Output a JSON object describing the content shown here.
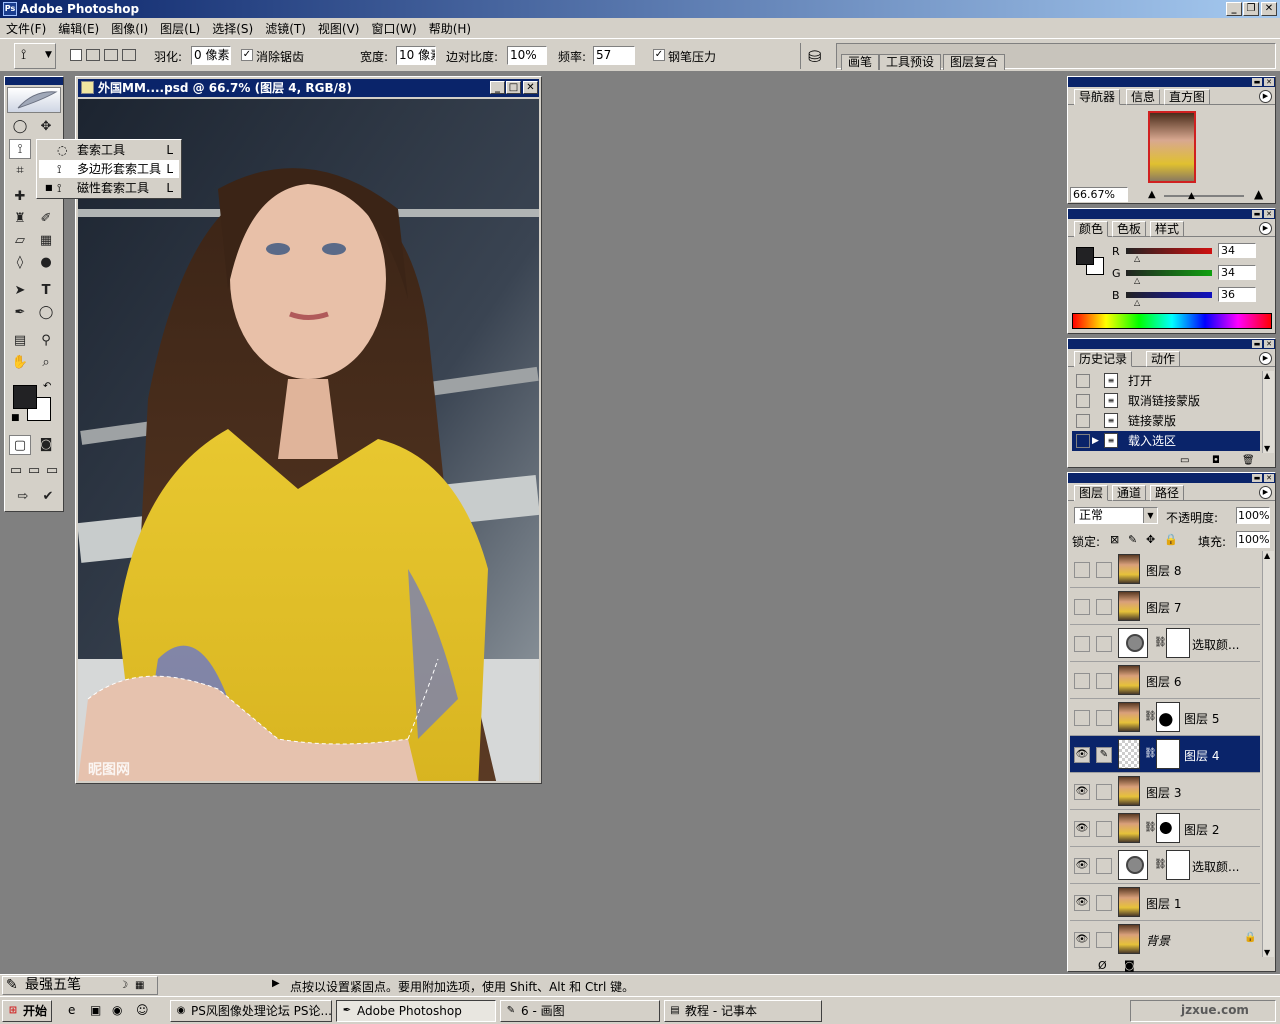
{
  "app": {
    "title": "Adobe Photoshop"
  },
  "menu": [
    "文件(F)",
    "编辑(E)",
    "图像(I)",
    "图层(L)",
    "选择(S)",
    "滤镜(T)",
    "视图(V)",
    "窗口(W)",
    "帮助(H)"
  ],
  "options": {
    "feather_label": "羽化:",
    "feather_value": "0 像素",
    "antialias_label": "消除锯齿",
    "width_label": "宽度:",
    "width_value": "10 像素",
    "edge_contrast_label": "边对比度:",
    "edge_contrast_value": "10%",
    "frequency_label": "频率:",
    "frequency_value": "57",
    "pen_pressure_label": "钢笔压力",
    "dock_tabs": [
      "画笔",
      "工具预设",
      "图层复合"
    ]
  },
  "flyout": {
    "items": [
      {
        "label": "套索工具",
        "key": "L"
      },
      {
        "label": "多边形套索工具",
        "key": "L"
      },
      {
        "label": "磁性套索工具",
        "key": "L"
      }
    ]
  },
  "document": {
    "title": "外国MM....psd @ 66.7% (图层 4, RGB/8)",
    "watermark": "昵图网"
  },
  "navigator": {
    "tabs": [
      "导航器",
      "信息",
      "直方图"
    ],
    "zoom": "66.67%"
  },
  "color": {
    "tabs": [
      "颜色",
      "色板",
      "样式"
    ],
    "channels": [
      {
        "name": "R",
        "value": "34",
        "color": "#d01010"
      },
      {
        "name": "G",
        "value": "34",
        "color": "#10a010"
      },
      {
        "name": "B",
        "value": "36",
        "color": "#1010c0"
      }
    ]
  },
  "history": {
    "tabs": [
      "历史记录",
      "动作"
    ],
    "items": [
      "打开",
      "取消链接蒙版",
      "链接蒙版",
      "载入选区"
    ]
  },
  "layers": {
    "tabs": [
      "图层",
      "通道",
      "路径"
    ],
    "blend_mode": "正常",
    "opacity_label": "不透明度:",
    "opacity_value": "100%",
    "lock_label": "锁定:",
    "fill_label": "填充:",
    "fill_value": "100%",
    "items": [
      {
        "name": "图层 8",
        "visible": false
      },
      {
        "name": "图层 7",
        "visible": false
      },
      {
        "name": "选取颜...",
        "visible": false
      },
      {
        "name": "图层 6",
        "visible": false
      },
      {
        "name": "图层 5",
        "visible": false
      },
      {
        "name": "图层 4",
        "visible": true
      },
      {
        "name": "图层 3",
        "visible": true
      },
      {
        "name": "图层 2",
        "visible": true
      },
      {
        "name": "选取颜...",
        "visible": true
      },
      {
        "name": "图层 1",
        "visible": true
      },
      {
        "name": "背景",
        "visible": true
      }
    ]
  },
  "status": {
    "ime": "最强五笔",
    "hint": "点按以设置紧固点。要用附加选项，使用 Shift、Alt 和 Ctrl 键。"
  },
  "taskbar": {
    "start": "开始",
    "items": [
      "PS风图像处理论坛 PS论...",
      "Adobe Photoshop",
      "6 - 画图",
      "教程 - 记事本"
    ],
    "watermark": "jzxue.com"
  }
}
